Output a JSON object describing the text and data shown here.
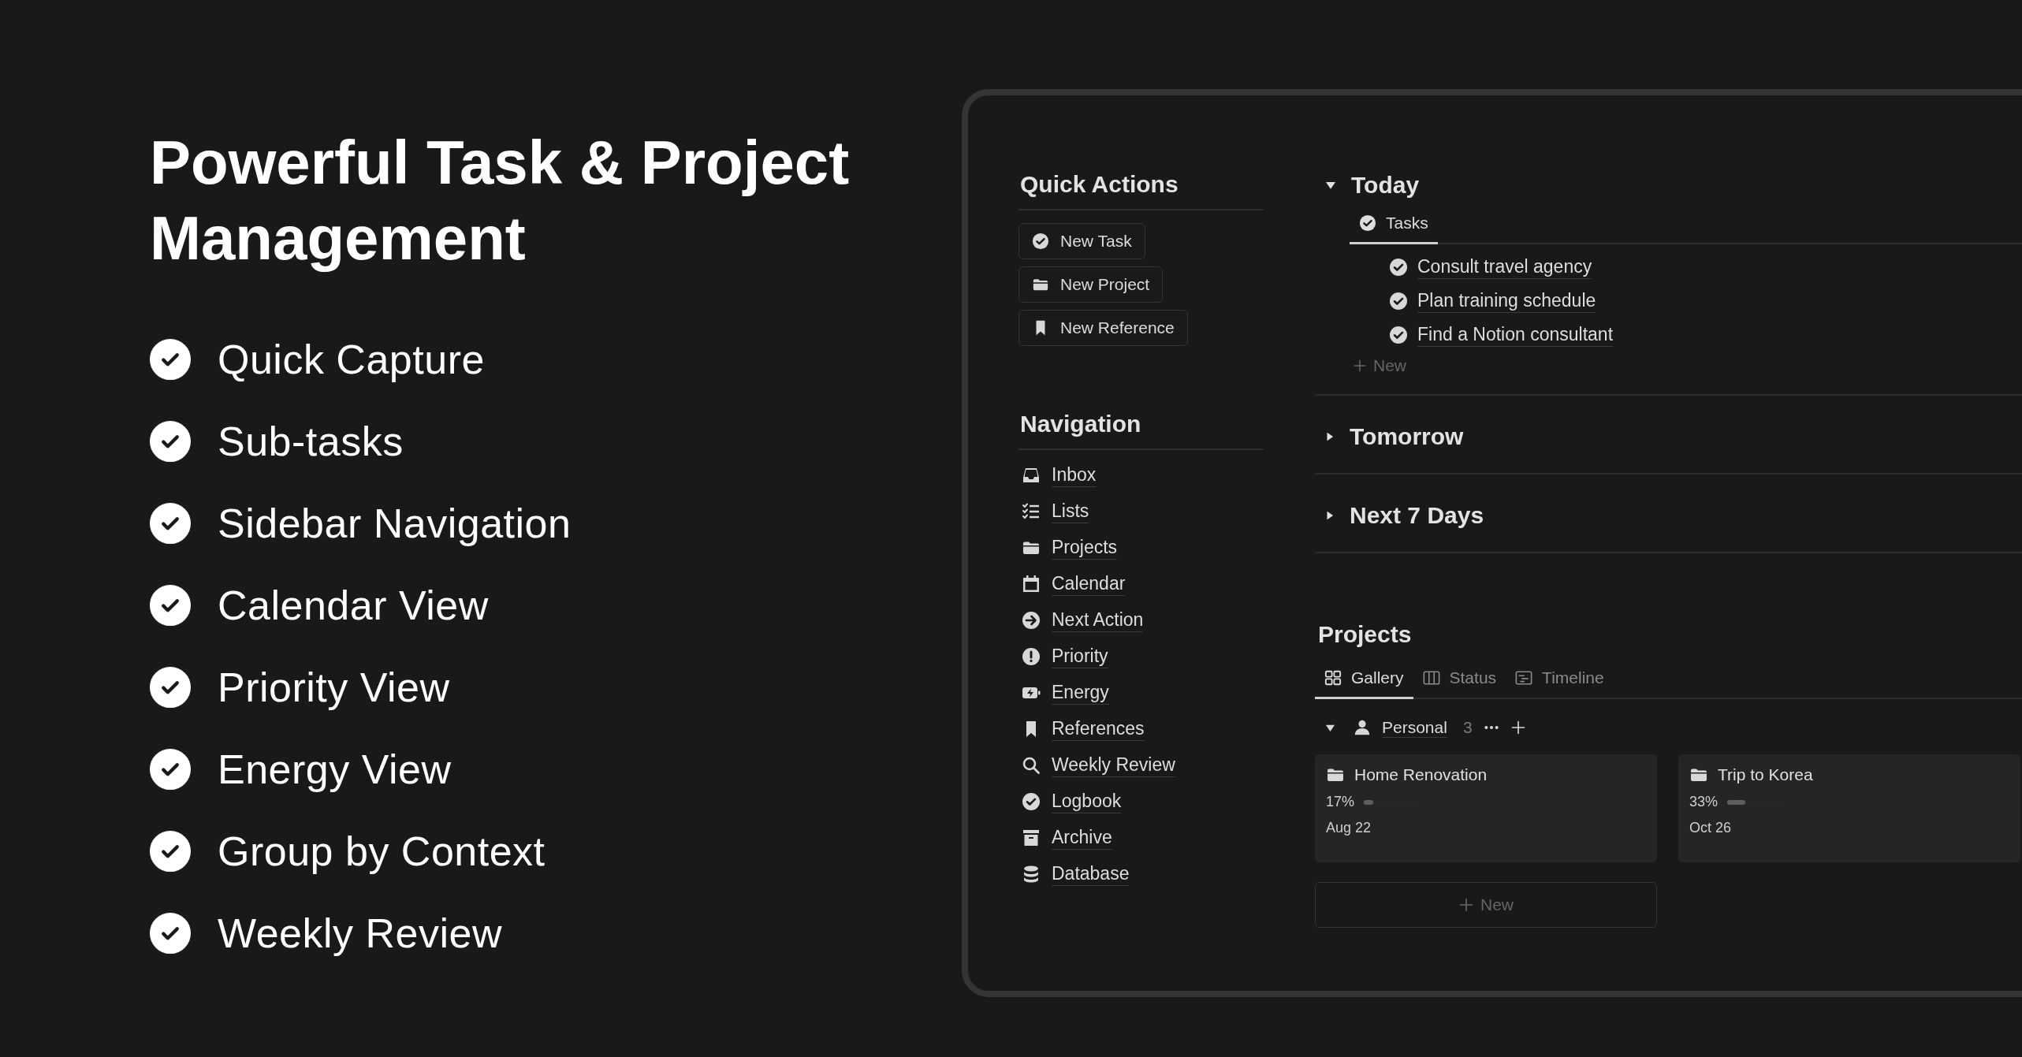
{
  "headline": "Powerful Task & Project Management",
  "features": [
    {
      "label": "Quick Capture",
      "checked": true
    },
    {
      "label": "Sub-tasks",
      "checked": true
    },
    {
      "label": "Sidebar Navigation",
      "checked": true
    },
    {
      "label": "Calendar View",
      "checked": true
    },
    {
      "label": "Priority View",
      "checked": true
    },
    {
      "label": "Energy View",
      "checked": true
    },
    {
      "label": "Group by Context",
      "checked": true
    },
    {
      "label": "Weekly Review",
      "checked": true
    }
  ],
  "app": {
    "quick_actions": {
      "title": "Quick Actions",
      "buttons": [
        "New Task",
        "New Project",
        "New Reference"
      ]
    },
    "navigation": {
      "title": "Navigation",
      "items": [
        "Inbox",
        "Lists",
        "Projects",
        "Calendar",
        "Next Action",
        "Priority",
        "Energy",
        "References",
        "Weekly Review",
        "Logbook",
        "Archive",
        "Database"
      ]
    },
    "sections": [
      {
        "title": "Today",
        "expanded": true,
        "tabs": [
          {
            "label": "Tasks",
            "selected": true
          }
        ],
        "tasks": [
          "Consult travel agency",
          "Plan training schedule",
          "Find a Notion consultant"
        ],
        "new_label": "New"
      },
      {
        "title": "Tomorrow",
        "expanded": false
      },
      {
        "title": "Next 7 Days",
        "expanded": false
      }
    ],
    "projects": {
      "title": "Projects",
      "tabs": [
        {
          "label": "Gallery",
          "selected": true
        },
        {
          "label": "Status",
          "selected": false
        },
        {
          "label": "Timeline",
          "selected": false
        }
      ],
      "group": {
        "name": "Personal",
        "count": "3",
        "expanded": true
      },
      "cards": [
        {
          "title": "Home Renovation",
          "percent": "17%",
          "level": 0.17,
          "date": "Aug 22"
        },
        {
          "title": "Trip to Korea",
          "percent": "33%",
          "level": 0.33,
          "date": "Oct 26"
        }
      ],
      "new_label": "New"
    }
  }
}
